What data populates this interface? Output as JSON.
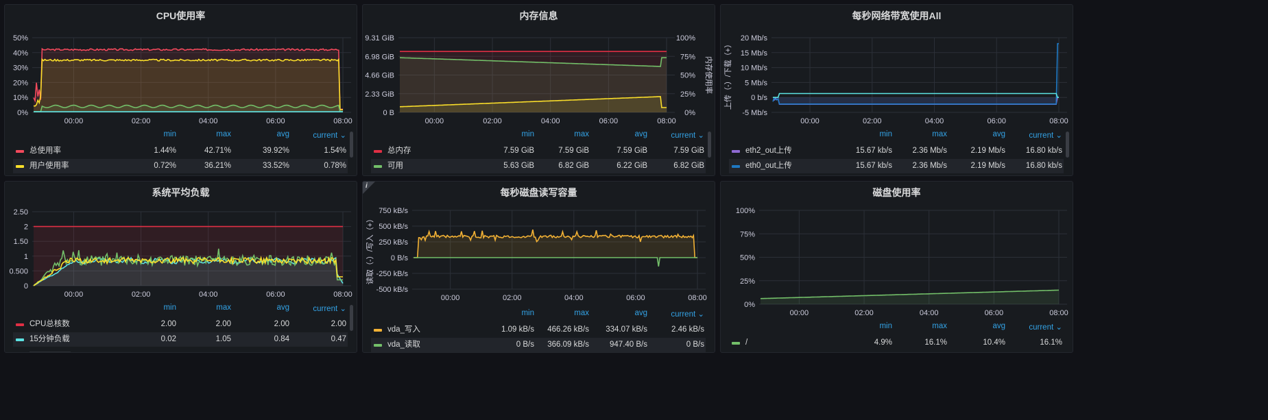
{
  "legend_headers": {
    "min": "min",
    "max": "max",
    "avg": "avg",
    "current": "current ⌄"
  },
  "panels": [
    {
      "title": "CPU使用率",
      "y_ticks": [
        "50%",
        "40%",
        "30%",
        "20%",
        "10%",
        "0%"
      ],
      "y2_ticks": [],
      "y2_label": "",
      "y_label": "",
      "x_ticks": [
        "00:00",
        "02:00",
        "04:00",
        "06:00",
        "08:00"
      ],
      "legend": [
        {
          "name": "总使用率",
          "color": "#f2495c",
          "min": "1.44%",
          "max": "42.71%",
          "avg": "39.92%",
          "current": "1.54%"
        },
        {
          "name": "用户使用率",
          "color": "#fade2a",
          "min": "0.72%",
          "max": "36.21%",
          "avg": "33.52%",
          "current": "0.78%"
        }
      ]
    },
    {
      "title": "内存信息",
      "y_ticks": [
        "9.31 GiB",
        "6.98 GiB",
        "4.66 GiB",
        "2.33 GiB",
        "0 B"
      ],
      "y2_ticks": [
        "100%",
        "75%",
        "50%",
        "25%",
        "0%"
      ],
      "y2_label": "内存使用率",
      "y_label": "",
      "x_ticks": [
        "00:00",
        "02:00",
        "04:00",
        "06:00",
        "08:00"
      ],
      "legend": [
        {
          "name": "总内存",
          "color": "#e02f44",
          "min": "7.59 GiB",
          "max": "7.59 GiB",
          "avg": "7.59 GiB",
          "current": "7.59 GiB"
        },
        {
          "name": "可用",
          "color": "#73bf69",
          "min": "5.63 GiB",
          "max": "6.82 GiB",
          "avg": "6.22 GiB",
          "current": "6.82 GiB"
        }
      ]
    },
    {
      "title": "每秒网络带宽使用All",
      "y_ticks": [
        "20 Mb/s",
        "15 Mb/s",
        "10 Mb/s",
        "5 Mb/s",
        "0 b/s",
        "-5 Mb/s"
      ],
      "y2_ticks": [],
      "y2_label": "",
      "y_label": "上传（-）/下载（+）",
      "x_ticks": [
        "00:00",
        "02:00",
        "04:00",
        "06:00",
        "08:00"
      ],
      "legend": [
        {
          "name": "eth2_out上传",
          "color": "#8f6ad2",
          "min": "15.67 kb/s",
          "max": "2.36 Mb/s",
          "avg": "2.19 Mb/s",
          "current": "16.80 kb/s"
        },
        {
          "name": "eth0_out上传",
          "color": "#1f78c1",
          "min": "15.67 kb/s",
          "max": "2.36 Mb/s",
          "avg": "2.19 Mb/s",
          "current": "16.80 kb/s"
        }
      ]
    },
    {
      "title": "系统平均负载",
      "y_ticks": [
        "2.50",
        "2",
        "1.50",
        "1",
        "0.500",
        "0"
      ],
      "y2_ticks": [],
      "y2_label": "",
      "y_label": "",
      "x_ticks": [
        "00:00",
        "02:00",
        "04:00",
        "06:00",
        "08:00"
      ],
      "legend": [
        {
          "name": "CPU总核数",
          "color": "#e02f44",
          "min": "2.00",
          "max": "2.00",
          "avg": "2.00",
          "current": "2.00"
        },
        {
          "name": "15分钟负载",
          "color": "#5ce3e3",
          "min": "0.02",
          "max": "1.05",
          "avg": "0.84",
          "current": "0.47"
        }
      ]
    },
    {
      "title": "每秒磁盘读写容量",
      "y_ticks": [
        "750 kB/s",
        "500 kB/s",
        "250 kB/s",
        "0 B/s",
        "-250 kB/s",
        "-500 kB/s"
      ],
      "y2_ticks": [],
      "y2_label": "",
      "y_label": "读取（-）/写入（+）",
      "x_ticks": [
        "00:00",
        "02:00",
        "04:00",
        "06:00",
        "08:00"
      ],
      "info": "i",
      "legend": [
        {
          "name": "vda_写入",
          "color": "#f2b135",
          "min": "1.09 kB/s",
          "max": "466.26 kB/s",
          "avg": "334.07 kB/s",
          "current": "2.46 kB/s"
        },
        {
          "name": "vda_读取",
          "color": "#73bf69",
          "min": "0 B/s",
          "max": "366.09 kB/s",
          "avg": "947.40 B/s",
          "current": "0 B/s"
        }
      ]
    },
    {
      "title": "磁盘使用率",
      "y_ticks": [
        "100%",
        "75%",
        "50%",
        "25%",
        "0%"
      ],
      "y2_ticks": [],
      "y2_label": "",
      "y_label": "",
      "x_ticks": [
        "00:00",
        "02:00",
        "04:00",
        "06:00",
        "08:00"
      ],
      "legend": [
        {
          "name": "/",
          "color": "#73bf69",
          "min": "4.9%",
          "max": "16.1%",
          "avg": "10.4%",
          "current": "16.1%"
        }
      ]
    }
  ],
  "chart_data": [
    {
      "type": "line",
      "title": "CPU使用率",
      "x": [
        "00:00",
        "02:00",
        "04:00",
        "06:00",
        "08:00"
      ],
      "ylim": [
        0,
        50
      ],
      "series": [
        {
          "name": "总使用率",
          "values": [
            42,
            42,
            42,
            42,
            42
          ]
        },
        {
          "name": "用户使用率",
          "values": [
            35,
            35,
            35,
            35,
            35
          ]
        }
      ]
    },
    {
      "type": "line",
      "title": "内存信息",
      "x": [
        "00:00",
        "02:00",
        "04:00",
        "06:00",
        "08:00"
      ],
      "ylim": [
        0,
        9.31
      ],
      "series": [
        {
          "name": "总内存",
          "values": [
            7.59,
            7.59,
            7.59,
            7.59,
            7.59
          ]
        },
        {
          "name": "可用",
          "values": [
            6.82,
            6.6,
            6.3,
            6.0,
            5.7
          ]
        }
      ]
    },
    {
      "type": "line",
      "title": "每秒网络带宽使用All",
      "x": [
        "00:00",
        "02:00",
        "04:00",
        "06:00",
        "08:00"
      ],
      "ylim": [
        -5,
        20
      ],
      "series": [
        {
          "name": "eth2_out上传",
          "values": [
            -2.2,
            -2.2,
            -2.2,
            -2.2,
            -2.2
          ]
        },
        {
          "name": "eth0_out上传",
          "values": [
            -2.2,
            -2.2,
            -2.2,
            -2.2,
            -2.2
          ]
        }
      ]
    },
    {
      "type": "line",
      "title": "系统平均负载",
      "x": [
        "00:00",
        "02:00",
        "04:00",
        "06:00",
        "08:00"
      ],
      "ylim": [
        0,
        2.5
      ],
      "series": [
        {
          "name": "CPU总核数",
          "values": [
            2,
            2,
            2,
            2,
            2
          ]
        },
        {
          "name": "15分钟负载",
          "values": [
            0.8,
            0.85,
            0.85,
            0.85,
            0.84
          ]
        }
      ]
    },
    {
      "type": "line",
      "title": "每秒磁盘读写容量",
      "x": [
        "00:00",
        "02:00",
        "04:00",
        "06:00",
        "08:00"
      ],
      "ylim": [
        -500,
        750
      ],
      "series": [
        {
          "name": "vda_写入",
          "values": [
            340,
            335,
            335,
            335,
            330
          ]
        },
        {
          "name": "vda_读取",
          "values": [
            0,
            0,
            0,
            0,
            0
          ]
        }
      ]
    },
    {
      "type": "line",
      "title": "磁盘使用率",
      "x": [
        "00:00",
        "02:00",
        "04:00",
        "06:00",
        "08:00"
      ],
      "ylim": [
        0,
        100
      ],
      "series": [
        {
          "name": "/",
          "values": [
            6,
            8,
            10,
            12,
            15
          ]
        }
      ]
    }
  ]
}
